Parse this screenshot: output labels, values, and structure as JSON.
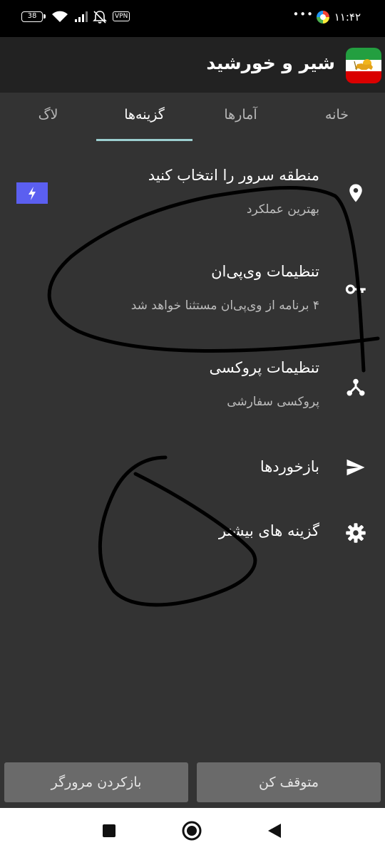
{
  "status_bar": {
    "time": "۱۱:۴۲",
    "battery": "38",
    "vpn_badge": "VPN",
    "dots": "•••"
  },
  "app": {
    "title": "شیر و خورشید"
  },
  "tabs": [
    {
      "label": "خانه"
    },
    {
      "label": "آمارها"
    },
    {
      "label": "گزینه‌ها"
    },
    {
      "label": "لاگ"
    }
  ],
  "settings": {
    "server_region": {
      "title": "منطقه سرور را انتخاب کنید",
      "subtitle": "بهترین عملکرد"
    },
    "vpn_settings": {
      "title": "تنظیمات وی‌پی‌ان",
      "subtitle": "۴ برنامه از وی‌پی‌ان مستثنا خواهد شد"
    },
    "proxy_settings": {
      "title": "تنظیمات پروکسی",
      "subtitle": "پروکسی سفارشی"
    },
    "feedback": {
      "title": "بازخوردها"
    },
    "more_options": {
      "title": "گزینه های بیشتر"
    }
  },
  "buttons": {
    "stop": "متوقف کن",
    "open_browser": "بازکردن مرورگر"
  },
  "colors": {
    "background": "#333333",
    "header": "#222222",
    "tab_indicator": "#9ccfd0",
    "lightning_badge": "#5b5ff0"
  },
  "icons": {
    "server_region": "location-pin-icon",
    "vpn_settings": "key-icon",
    "proxy_settings": "network-icon",
    "feedback": "send-icon",
    "more_options": "gear-icon",
    "badge": "lightning-icon"
  }
}
